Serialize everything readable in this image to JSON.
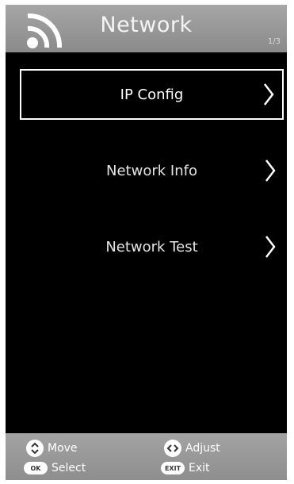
{
  "header": {
    "title": "Network",
    "page_indicator": "1/3",
    "icon": "wifi-signal-icon"
  },
  "menu": {
    "items": [
      {
        "label": "IP Config",
        "selected": true,
        "icon": "chevron-right-icon"
      },
      {
        "label": "Network Info",
        "selected": false,
        "icon": "chevron-right-icon"
      },
      {
        "label": "Network Test",
        "selected": false,
        "icon": "chevron-right-icon"
      }
    ]
  },
  "footer": {
    "move_label": "Move",
    "adjust_label": "Adjust",
    "select_label": "Select",
    "exit_label": "Exit",
    "ok_key": "OK",
    "exit_key": "EXIT",
    "icons": [
      "up-down-arrows-icon",
      "left-right-arrows-icon",
      "ok-key-icon",
      "exit-key-icon"
    ]
  },
  "colors": {
    "background": "#000000",
    "bar_gray": "#999999",
    "text": "#ffffff",
    "selection_border": "#ffffff"
  }
}
